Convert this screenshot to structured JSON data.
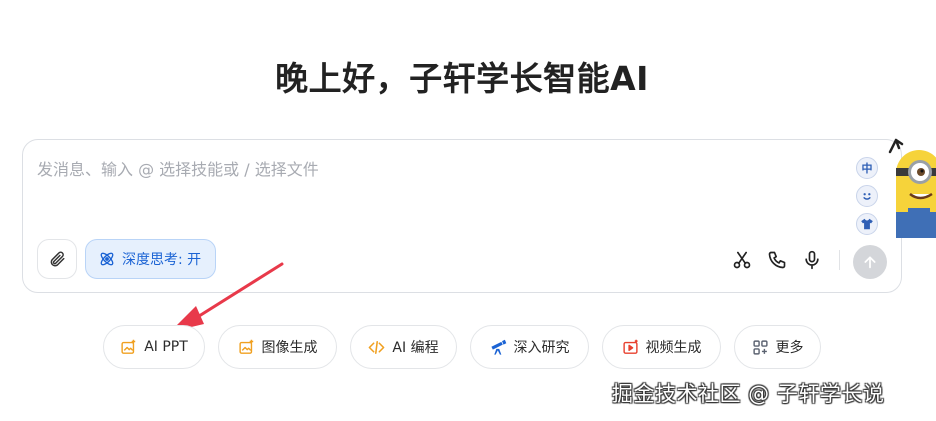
{
  "greeting": "晚上好，子轩学长智能AI",
  "chat": {
    "placeholder": "发消息、输入 @ 选择技能或 / 选择文件",
    "deep_thinking_label": "深度思考: 开",
    "side_badge": "中"
  },
  "quick_actions": [
    {
      "label": "AI PPT",
      "icon": "image-sparkle-icon",
      "color": "#f0a020"
    },
    {
      "label": "图像生成",
      "icon": "image-icon",
      "color": "#f0a020"
    },
    {
      "label": "AI 编程",
      "icon": "code-icon",
      "color": "#f0a020"
    },
    {
      "label": "深入研究",
      "icon": "telescope-icon",
      "color": "#1b63d4"
    },
    {
      "label": "视频生成",
      "icon": "video-icon",
      "color": "#e8412f"
    },
    {
      "label": "更多",
      "icon": "grid-icon",
      "color": "#5b6270"
    }
  ],
  "watermark": "掘金技术社区 @ 子轩学长说",
  "colors": {
    "accent": "#1b63d4",
    "annotation_arrow": "#e8394a"
  }
}
